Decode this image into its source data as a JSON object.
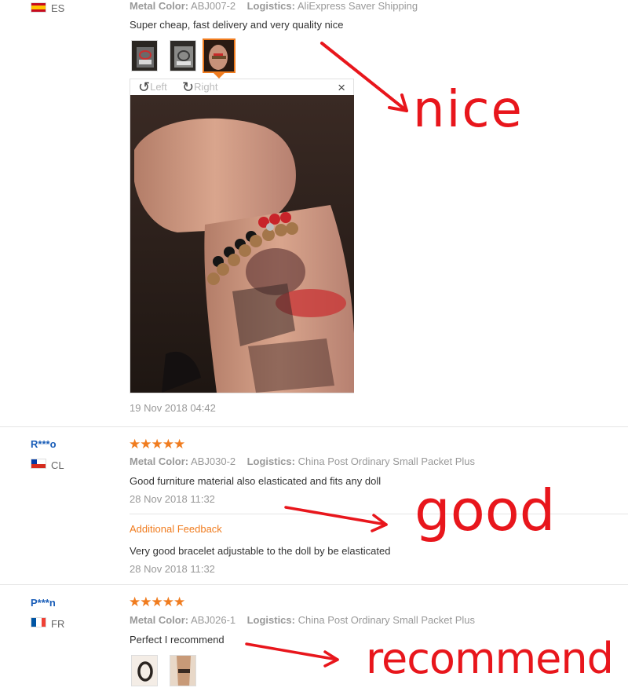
{
  "reviews": [
    {
      "country": "ES",
      "meta_color_label": "Metal Color:",
      "meta_color_value": "ABJ007-2",
      "meta_logistics_label": "Logistics:",
      "meta_logistics_value": "AliExpress Saver Shipping",
      "text": "Super cheap, fast delivery and very quality nice",
      "viewer": {
        "rotate_left": "Left",
        "rotate_right": "Right",
        "close": "×"
      },
      "date": "19 Nov 2018 04:42"
    },
    {
      "user": "R***o",
      "country": "CL",
      "stars": "★★★★★",
      "meta_color_label": "Metal Color:",
      "meta_color_value": "ABJ030-2",
      "meta_logistics_label": "Logistics:",
      "meta_logistics_value": "China Post Ordinary Small Packet Plus",
      "text": "Good furniture material also elasticated and fits any doll",
      "date": "28 Nov 2018 11:32",
      "additional_label": "Additional Feedback",
      "additional_text": "Very good bracelet adjustable to the doll by be elasticated",
      "additional_date": "28 Nov 2018 11:32"
    },
    {
      "user": "P***n",
      "country": "FR",
      "stars": "★★★★★",
      "meta_color_label": "Metal Color:",
      "meta_color_value": "ABJ026-1",
      "meta_logistics_label": "Logistics:",
      "meta_logistics_value": "China Post Ordinary Small Packet Plus",
      "text": "Perfect I recommend"
    }
  ],
  "annotations": {
    "first": "nice",
    "second": "good",
    "third": "recommend",
    "color": "#e8161c"
  },
  "colors": {
    "accent": "#f07c1f",
    "username": "#1a5eb8",
    "muted": "#999999"
  }
}
